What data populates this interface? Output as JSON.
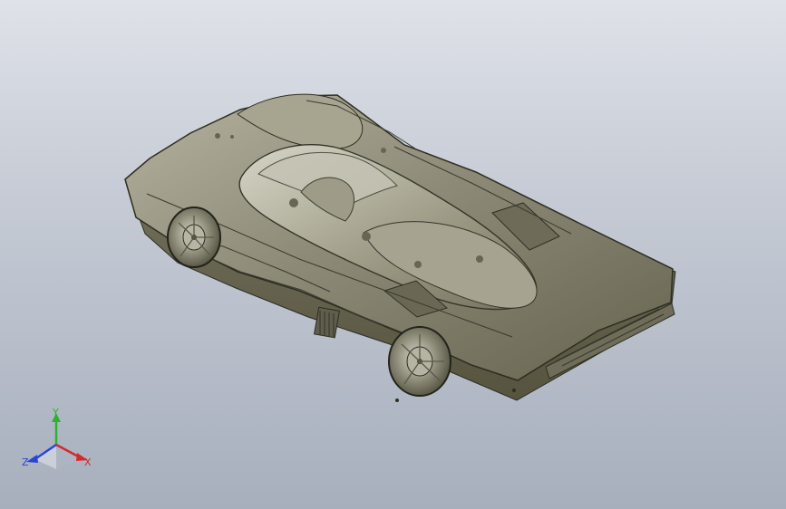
{
  "viewport": {
    "background_top": "#dfe2e8",
    "background_bottom": "#a7afbd",
    "model_color": "#8d8b77"
  },
  "triad": {
    "y_label": "Y",
    "x_label": "X",
    "z_label": "Z",
    "y_color": "#2fb12f",
    "x_color": "#d42a2a",
    "z_color": "#2b44d8"
  }
}
